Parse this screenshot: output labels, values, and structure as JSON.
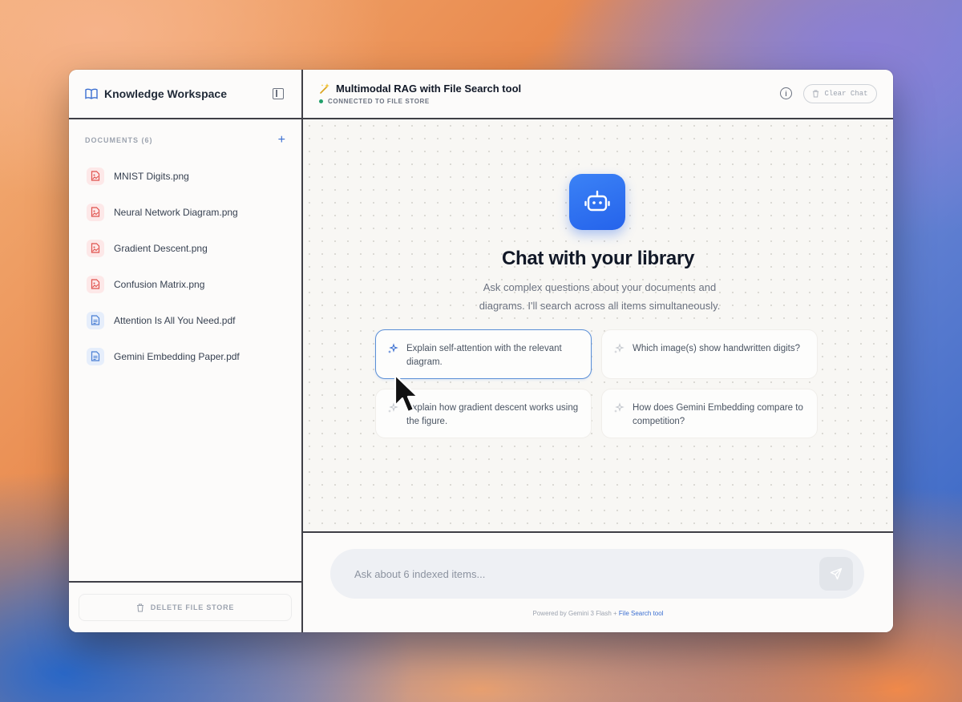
{
  "sidebar": {
    "title": "Knowledge Workspace",
    "documents_label": "DOCUMENTS (6)",
    "add_icon": "+",
    "documents": [
      {
        "name": "MNIST Digits.png",
        "type": "image"
      },
      {
        "name": "Neural Network Diagram.png",
        "type": "image"
      },
      {
        "name": "Gradient Descent.png",
        "type": "image"
      },
      {
        "name": "Confusion Matrix.png",
        "type": "image"
      },
      {
        "name": "Attention Is All You Need.pdf",
        "type": "pdf"
      },
      {
        "name": "Gemini Embedding Paper.pdf",
        "type": "pdf"
      }
    ],
    "delete_label": "DELETE FILE STORE"
  },
  "header": {
    "title": "Multimodal RAG with File Search tool",
    "status": "CONNECTED TO FILE STORE",
    "info_icon": "i",
    "clear_label": "Clear Chat"
  },
  "welcome": {
    "title": "Chat with your library",
    "subtitle": "Ask complex questions about your documents and diagrams. I'll search across all items simultaneously."
  },
  "suggestions": [
    "Explain self-attention with the relevant diagram.",
    "Which image(s) show handwritten digits?",
    "Explain how gradient descent works using the figure.",
    "How does Gemini Embedding compare to competition?"
  ],
  "input": {
    "placeholder": "Ask about 6 indexed items..."
  },
  "footer": {
    "powered_prefix": "Powered by Gemini 3 Flash + ",
    "powered_link": "File Search tool"
  },
  "colors": {
    "accent": "#3b82f6",
    "status_green": "#22a06b",
    "image_icon_bg": "#fde8e8",
    "pdf_icon_bg": "#e6eefb"
  }
}
